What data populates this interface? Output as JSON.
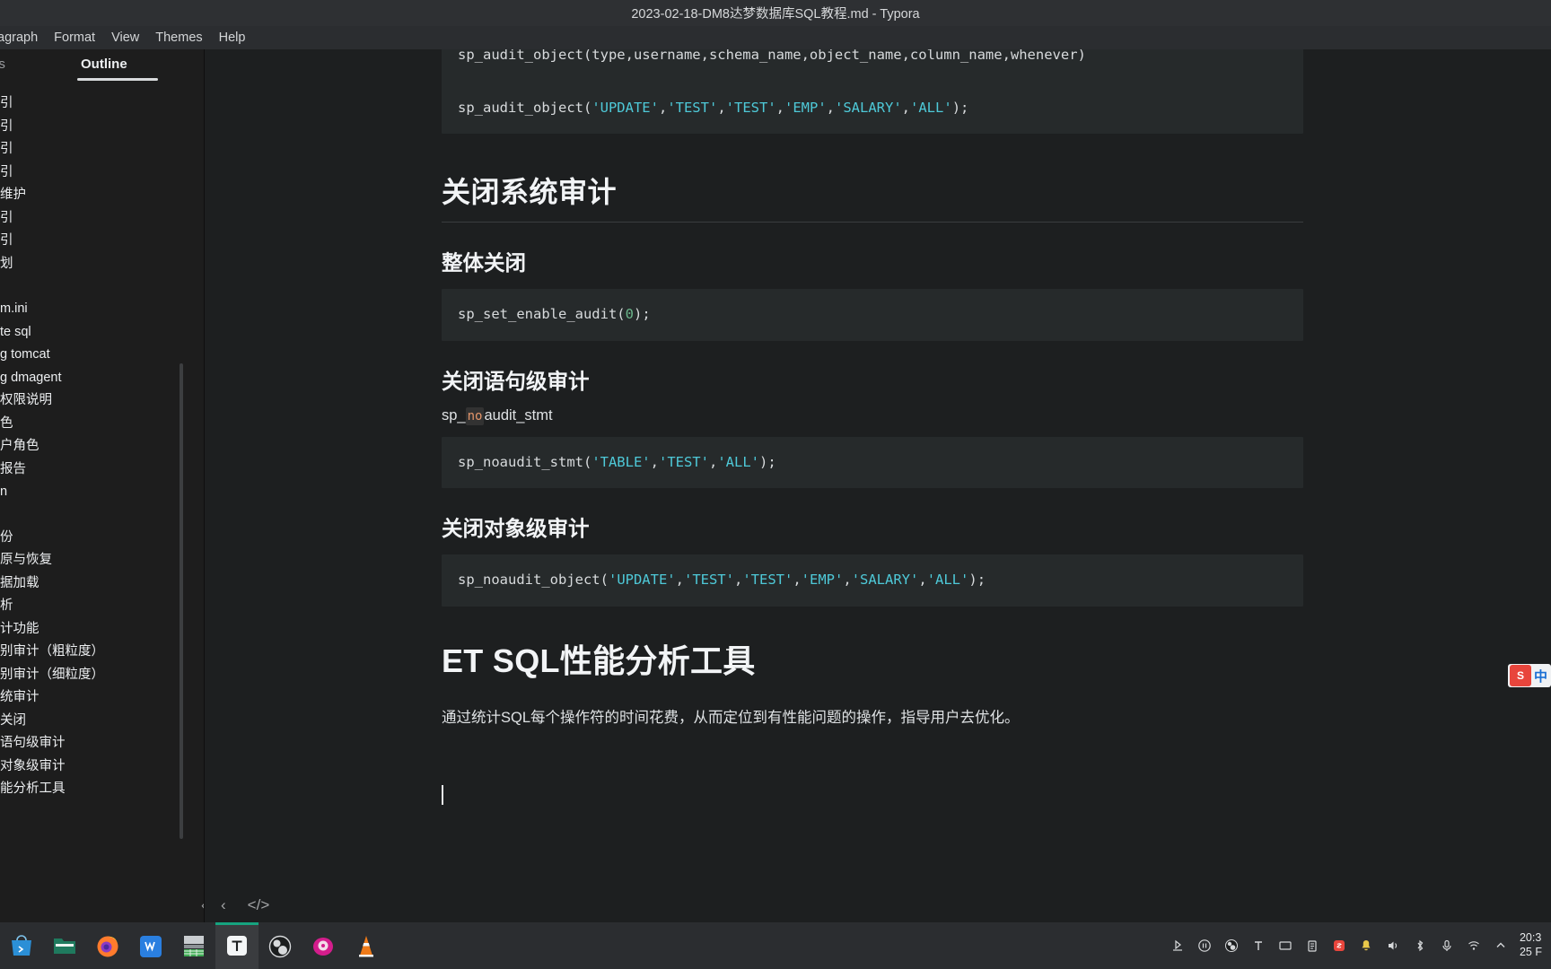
{
  "window": {
    "title": "2023-02-18-DM8达梦数据库SQL教程.md - Typora"
  },
  "menu": {
    "items": [
      {
        "label": "agraph",
        "name": "menu-paragraph"
      },
      {
        "label": "Format",
        "name": "menu-format"
      },
      {
        "label": "View",
        "name": "menu-view"
      },
      {
        "label": "Themes",
        "name": "menu-themes"
      },
      {
        "label": "Help",
        "name": "menu-help"
      }
    ]
  },
  "sidebar": {
    "tab_files": "es",
    "tab_outline": "Outline",
    "outline_items": [
      "引",
      "引",
      "引",
      "引",
      "维护",
      "引",
      "引",
      "划",
      "",
      "m.ini",
      "te sql",
      "g tomcat",
      "g dmagent",
      "权限说明",
      "色",
      "户角色",
      "报告",
      "n",
      "",
      "份",
      "原与恢复",
      "据加载",
      "析",
      "计功能",
      "别审计（粗粒度）",
      "别审计（细粒度）",
      "统审计",
      "关闭",
      "语句级审计",
      "对象级审计",
      "能分析工具"
    ],
    "footer": {
      "back_label": "‹",
      "source_label": "</>"
    }
  },
  "document": {
    "code_top_line1_prefix": "sp_audit_object(type,username,schema_name,object_name,column_name,whenever)",
    "code_top_line2": {
      "prefix": "sp_audit_object(",
      "args": [
        "'UPDATE'",
        "'TEST'",
        "'TEST'",
        "'EMP'",
        "'SALARY'",
        "'ALL'"
      ],
      "suffix": ");"
    },
    "h2_close_system_audit": "关闭系统审计",
    "h3_overall_close": "整体关闭",
    "code_set_enable_prefix": "sp_set_enable_audit(",
    "code_set_enable_num": "0",
    "code_set_enable_suffix": ");",
    "h3_close_statement_audit": "关闭语句级审计",
    "inline_line_pre": "sp_",
    "inline_code": "no",
    "inline_line_post": "audit_stmt",
    "code_noaudit_stmt": {
      "prefix": "sp_noaudit_stmt(",
      "args": [
        "'TABLE'",
        "'TEST'",
        "'ALL'"
      ],
      "suffix": ");"
    },
    "h3_close_object_audit": "关闭对象级审计",
    "code_noaudit_object": {
      "prefix": "sp_noaudit_object(",
      "args": [
        "'UPDATE'",
        "'TEST'",
        "'TEST'",
        "'EMP'",
        "'SALARY'",
        "'ALL'"
      ],
      "suffix": ");"
    },
    "h1_et_sql_tool": "ET SQL性能分析工具",
    "paragraph": "通过统计SQL每个操作符的时间花费，从而定位到有性能问题的操作，指导用户去优化。"
  },
  "ime": {
    "logo_text": "S",
    "mode_label": "中"
  },
  "taskbar": {
    "apps": [
      {
        "name": "app-store",
        "label": "App Store"
      },
      {
        "name": "file-manager",
        "label": "Files"
      },
      {
        "name": "firefox",
        "label": "Firefox"
      },
      {
        "name": "wps-writer",
        "label": "WPS"
      },
      {
        "name": "spreadsheet",
        "label": "Spreadsheet"
      },
      {
        "name": "typora",
        "label": "Typora"
      },
      {
        "name": "obs-studio",
        "label": "OBS"
      },
      {
        "name": "media-player",
        "label": "Player"
      },
      {
        "name": "vlc",
        "label": "VLC"
      }
    ],
    "clock_time": "20:3",
    "clock_date": "25 F"
  },
  "colors": {
    "background": "#1d1f20",
    "sidebar_bg": "#1d1d1d",
    "titlebar_bg": "#2e3033",
    "code_bg": "#262a2b",
    "string": "#4ec9d8",
    "number": "#6bb58b",
    "inline_code": "#e3956a",
    "accent": "#16a37f"
  }
}
